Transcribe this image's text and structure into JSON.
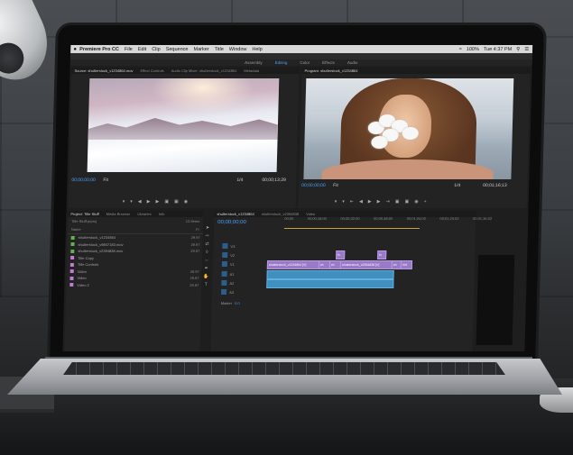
{
  "menubar": {
    "apple": "",
    "app_name": "Premiere Pro CC",
    "items": [
      "File",
      "Edit",
      "Clip",
      "Sequence",
      "Marker",
      "Title",
      "Window",
      "Help"
    ],
    "battery": "100%",
    "clock": "Tue 4:37 PM"
  },
  "workspace_tabs": [
    "Assembly",
    "Editing",
    "Color",
    "Effects",
    "Audio"
  ],
  "source_panel": {
    "tabs": [
      "Source: shutterstock_v1234864.mov",
      "Effect Controls",
      "Audio Clip Mixer: shutterstock_v1234864",
      "Metadata"
    ],
    "timecode_left": "00;00;00;00",
    "fit": "Fit",
    "scale": "1/4",
    "timecode_right": "00;00;13;29"
  },
  "program_panel": {
    "tabs": [
      "Program: shutterstock_v1234864"
    ],
    "timecode_left": "00;00;00;00",
    "fit": "Fit",
    "scale": "1/4",
    "timecode_right": "00;01;16;13"
  },
  "project_panel": {
    "tabs": [
      "Project: Title Stuff",
      "Media Browser",
      "Libraries",
      "Info"
    ],
    "file": "Title Stuff.prproj",
    "count": "13 Items",
    "col_name": "Name",
    "col_rate": "Fr",
    "items": [
      {
        "name": "shutterstock_v1234864",
        "dur": "29.97",
        "color": "#5fb14e"
      },
      {
        "name": "shutterstock_v9847183.mov",
        "dur": "29.97",
        "color": "#5fb14e"
      },
      {
        "name": "shutterstock_v2394838.mov",
        "dur": "29.97",
        "color": "#5fb14e"
      },
      {
        "name": "Title Copy",
        "dur": "",
        "color": "#c17bd3"
      },
      {
        "name": "Title Controls",
        "dur": "",
        "color": "#c17bd3"
      },
      {
        "name": "Video",
        "dur": "29.97",
        "color": "#c17bd3"
      },
      {
        "name": "Video",
        "dur": "29.97",
        "color": "#c17bd3"
      },
      {
        "name": "Video 2",
        "dur": "29.97",
        "color": "#c17bd3"
      }
    ]
  },
  "timeline": {
    "tabs": [
      "shutterstock_v1234864",
      "shutterstock_v2394838",
      "Video"
    ],
    "timecode": "00;00;00;00",
    "ruler": [
      "00;00",
      "00;00;16;00",
      "00;00;32;00",
      "00;00;48;00",
      "00;01;04;02",
      "00;01;20;02",
      "00;01;36;02"
    ],
    "tracks": {
      "v3": "V3",
      "v2": "V2",
      "v1": "V1",
      "a1": "A1",
      "a2": "A2",
      "a3": "A3",
      "master": "Master",
      "master_val": "0.0"
    },
    "clips": [
      {
        "label": "shutterstock_v1234864 [V]"
      },
      {
        "label": "sh"
      },
      {
        "label": "sh"
      },
      {
        "label": "shutterstock_v2394838 [V]"
      },
      {
        "label": "sh"
      },
      {
        "label": "Vid"
      }
    ],
    "fx_badges": [
      "fx",
      "fx"
    ]
  },
  "colors": {
    "accent_blue": "#4a9df0",
    "video_clip": "#9a79c9",
    "audio_clip": "#3f8fbf"
  }
}
